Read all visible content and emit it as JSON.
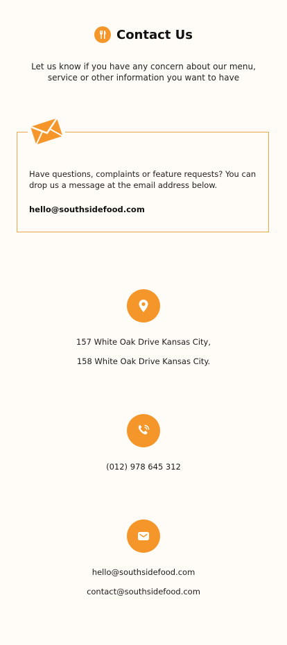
{
  "header": {
    "title": "Contact Us",
    "logo_icon": "fork-knife-icon"
  },
  "intro": "Let us know if you have any concern about our menu, service or other information you want to have",
  "card": {
    "icon": "envelope-icon",
    "text": "Have questions, complaints or feature requests? You can drop us a message at the email address below.",
    "email": "hello@southsidefood.com"
  },
  "address": {
    "icon": "location-pin-icon",
    "line1": "157 White Oak Drive Kansas City,",
    "line2": "158 White Oak Drive Kansas City."
  },
  "phone": {
    "icon": "phone-icon",
    "number": "(012) 978 645 312"
  },
  "email": {
    "icon": "mail-icon",
    "line1": "hello@southsidefood.com",
    "line2": "contact@southsidefood.com"
  },
  "colors": {
    "accent": "#f4962a",
    "background": "#fffcf7",
    "card_border": "#e9a949"
  }
}
